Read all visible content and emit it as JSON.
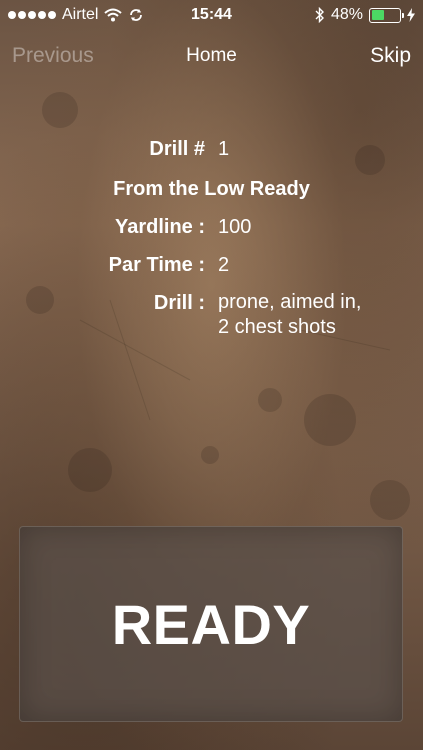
{
  "statusbar": {
    "carrier": "Airtel",
    "time": "15:44",
    "battery_percent": "48%",
    "battery_level": 0.48,
    "battery_color": "#4cd964",
    "icons": [
      "signal-dots-icon",
      "wifi-icon",
      "sync-icon",
      "bluetooth-icon",
      "battery-icon",
      "charging-bolt-icon"
    ]
  },
  "nav": {
    "previous_label": "Previous",
    "title": "Home",
    "skip_label": "Skip"
  },
  "drill": {
    "number_label": "Drill #",
    "number_value": "1",
    "position": "From the Low Ready",
    "yardline_label": "Yardline :",
    "yardline_value": "100",
    "par_time_label": "Par Time :",
    "par_time_value": "2",
    "drill_label": "Drill :",
    "drill_line1": "prone, aimed in,",
    "drill_line2": "2 chest shots"
  },
  "ready_button": {
    "label": "READY"
  }
}
